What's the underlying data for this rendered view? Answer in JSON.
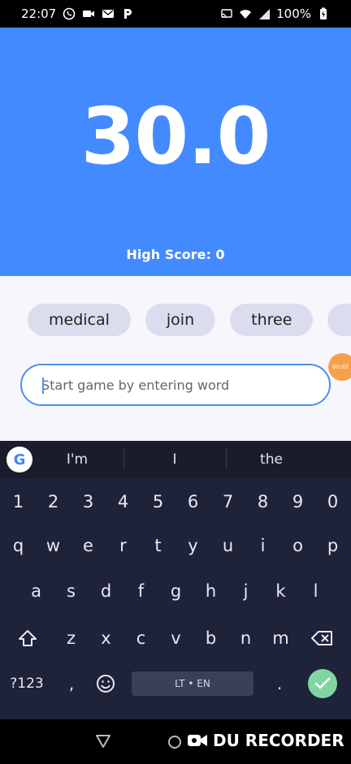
{
  "status_bar": {
    "time": "22:07",
    "battery_text": "100%",
    "left_icons": [
      "whatsapp-icon",
      "video-camera-icon",
      "gmail-icon",
      "p-app-icon"
    ],
    "right_icons": [
      "cast-icon",
      "wifi-icon",
      "signal-icon",
      "battery-charging-icon"
    ]
  },
  "header": {
    "background": "#448aff",
    "timer": "30.0",
    "high_score": "High Score: 0"
  },
  "words": {
    "chips": [
      "medical",
      "join",
      "three"
    ]
  },
  "input": {
    "placeholder": "Start game by entering word",
    "value": ""
  },
  "recorder_bubble": {
    "text": "00:02"
  },
  "keyboard": {
    "suggestions": [
      "I'm",
      "I",
      "the"
    ],
    "number_row": [
      "1",
      "2",
      "3",
      "4",
      "5",
      "6",
      "7",
      "8",
      "9",
      "0"
    ],
    "row1": [
      "q",
      "w",
      "e",
      "r",
      "t",
      "y",
      "u",
      "i",
      "o",
      "p"
    ],
    "row2": [
      "a",
      "s",
      "d",
      "f",
      "g",
      "h",
      "j",
      "k",
      "l"
    ],
    "row3": [
      "z",
      "x",
      "c",
      "v",
      "b",
      "n",
      "m"
    ],
    "symbols_label": "?123",
    "comma": ",",
    "period": ".",
    "space_label": "LT • EN",
    "accent": "#7fd6a2"
  },
  "navbar": {
    "recorder_label": "DU RECORDER"
  }
}
